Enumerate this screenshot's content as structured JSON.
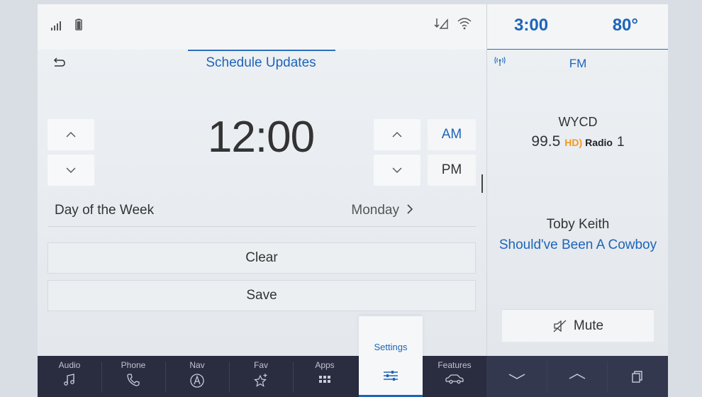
{
  "status": {
    "signal_icon": "signal-bars-icon",
    "battery_icon": "battery-icon",
    "data_icon": "data-arrows-icon",
    "wifi_icon": "wifi-icon"
  },
  "header": {
    "title": "Schedule Updates",
    "back_icon": "back-arrow-icon"
  },
  "time_picker": {
    "time": "12:00",
    "am_label": "AM",
    "pm_label": "PM",
    "selected_period": "AM"
  },
  "day_row": {
    "label": "Day of the Week",
    "value": "Monday"
  },
  "actions": {
    "clear_label": "Clear",
    "save_label": "Save"
  },
  "side": {
    "clock": "3:00",
    "temperature": "80°",
    "band": "FM",
    "station": "WYCD",
    "frequency": "99.5",
    "hd_prefix": "HD",
    "hd_word": "Radio",
    "hd_channel": "1",
    "artist": "Toby Keith",
    "song": "Should've Been A Cowboy",
    "mute_label": "Mute"
  },
  "nav": {
    "items": [
      {
        "label": "Audio",
        "icon": "music-note-icon"
      },
      {
        "label": "Phone",
        "icon": "phone-icon"
      },
      {
        "label": "Nav",
        "icon": "navigation-icon"
      },
      {
        "label": "Fav",
        "icon": "star-plus-icon"
      },
      {
        "label": "Apps",
        "icon": "apps-grid-icon"
      },
      {
        "label": "Settings",
        "icon": "sliders-icon"
      },
      {
        "label": "Features",
        "icon": "car-icon"
      }
    ],
    "active": "Settings"
  },
  "colors": {
    "accent": "#1e64b8",
    "nav_bg": "#2a2d40",
    "hd_orange": "#f29a1d"
  }
}
